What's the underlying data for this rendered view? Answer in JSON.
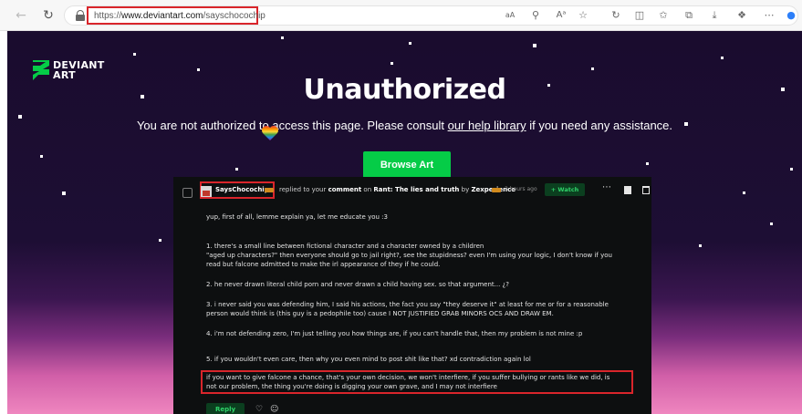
{
  "browser": {
    "url_prefix": "https://",
    "url_host": "www.deviantart.com",
    "url_path": "/sayschocochip",
    "toolbar_icons": [
      "back-icon",
      "refresh-icon",
      "lock-icon",
      "read-aloud-icon",
      "zoom-icon",
      "text-size-icon",
      "favorite-star-icon",
      "refresh-page-icon",
      "split-screen-icon",
      "favorites-icon",
      "collections-icon",
      "downloads-icon",
      "extensions-icon",
      "more-icon"
    ]
  },
  "page": {
    "logo_line1": "DEVIANT",
    "logo_line2": "ART",
    "title": "Unauthorized",
    "message_before": "You are not authorized to access this page. Please consult ",
    "help_link": "our help library",
    "message_after": " if you need any assistance.",
    "browse_button": "Browse Art"
  },
  "comment": {
    "username": "SaysChocochip",
    "action_text": "replied to your ",
    "action_link": "comment",
    "on_text": " on ",
    "thread_title": "Rant: The lies and truth",
    "by_text": " by ",
    "author": "Zexperience",
    "time": "3 hours ago",
    "watch_button": "+ Watch",
    "lines": [
      "yup, first of all, lemme explain ya, let me educate you :3",
      "1. there's a small line between fictional character and a character owned by a children",
      "\"aged up characters?\" then everyone should go to jail right?, see the stupidness? even I'm using your logic, I don't know if you",
      "read but falcone admitted to make the irl appearance of they if he could.",
      "2. he never drawn literal child porn and never drawn a child having sex. so that argument... ¿?",
      "3. i never said you was defending him, I said his actions, the fact you say \"they deserve it\" at least for me or for a reasonable",
      "person would think is (this guy is a pedophile too) cause I NOT JUSTIFIED GRAB MINORS OCS AND DRAW EM.",
      "4. i'm not defending zero, I'm just telling you how things are, if you can't handle that, then my problem is not mine :p",
      "5. if you wouldn't even care, then why you even mind to post shit like that? xd contradiction again lol",
      "if you want to give falcone a chance, that's your own decision, we won't interfiere, if you suffer bullying or rants like we did, is",
      "not our problem, the thing you're doing is digging your own grave, and I may not interfiere"
    ],
    "reply_button": "Reply"
  },
  "colors": {
    "accent_green": "#05cc47",
    "highlight_red": "#d9252b",
    "badge_orange": "#d08a1d"
  }
}
